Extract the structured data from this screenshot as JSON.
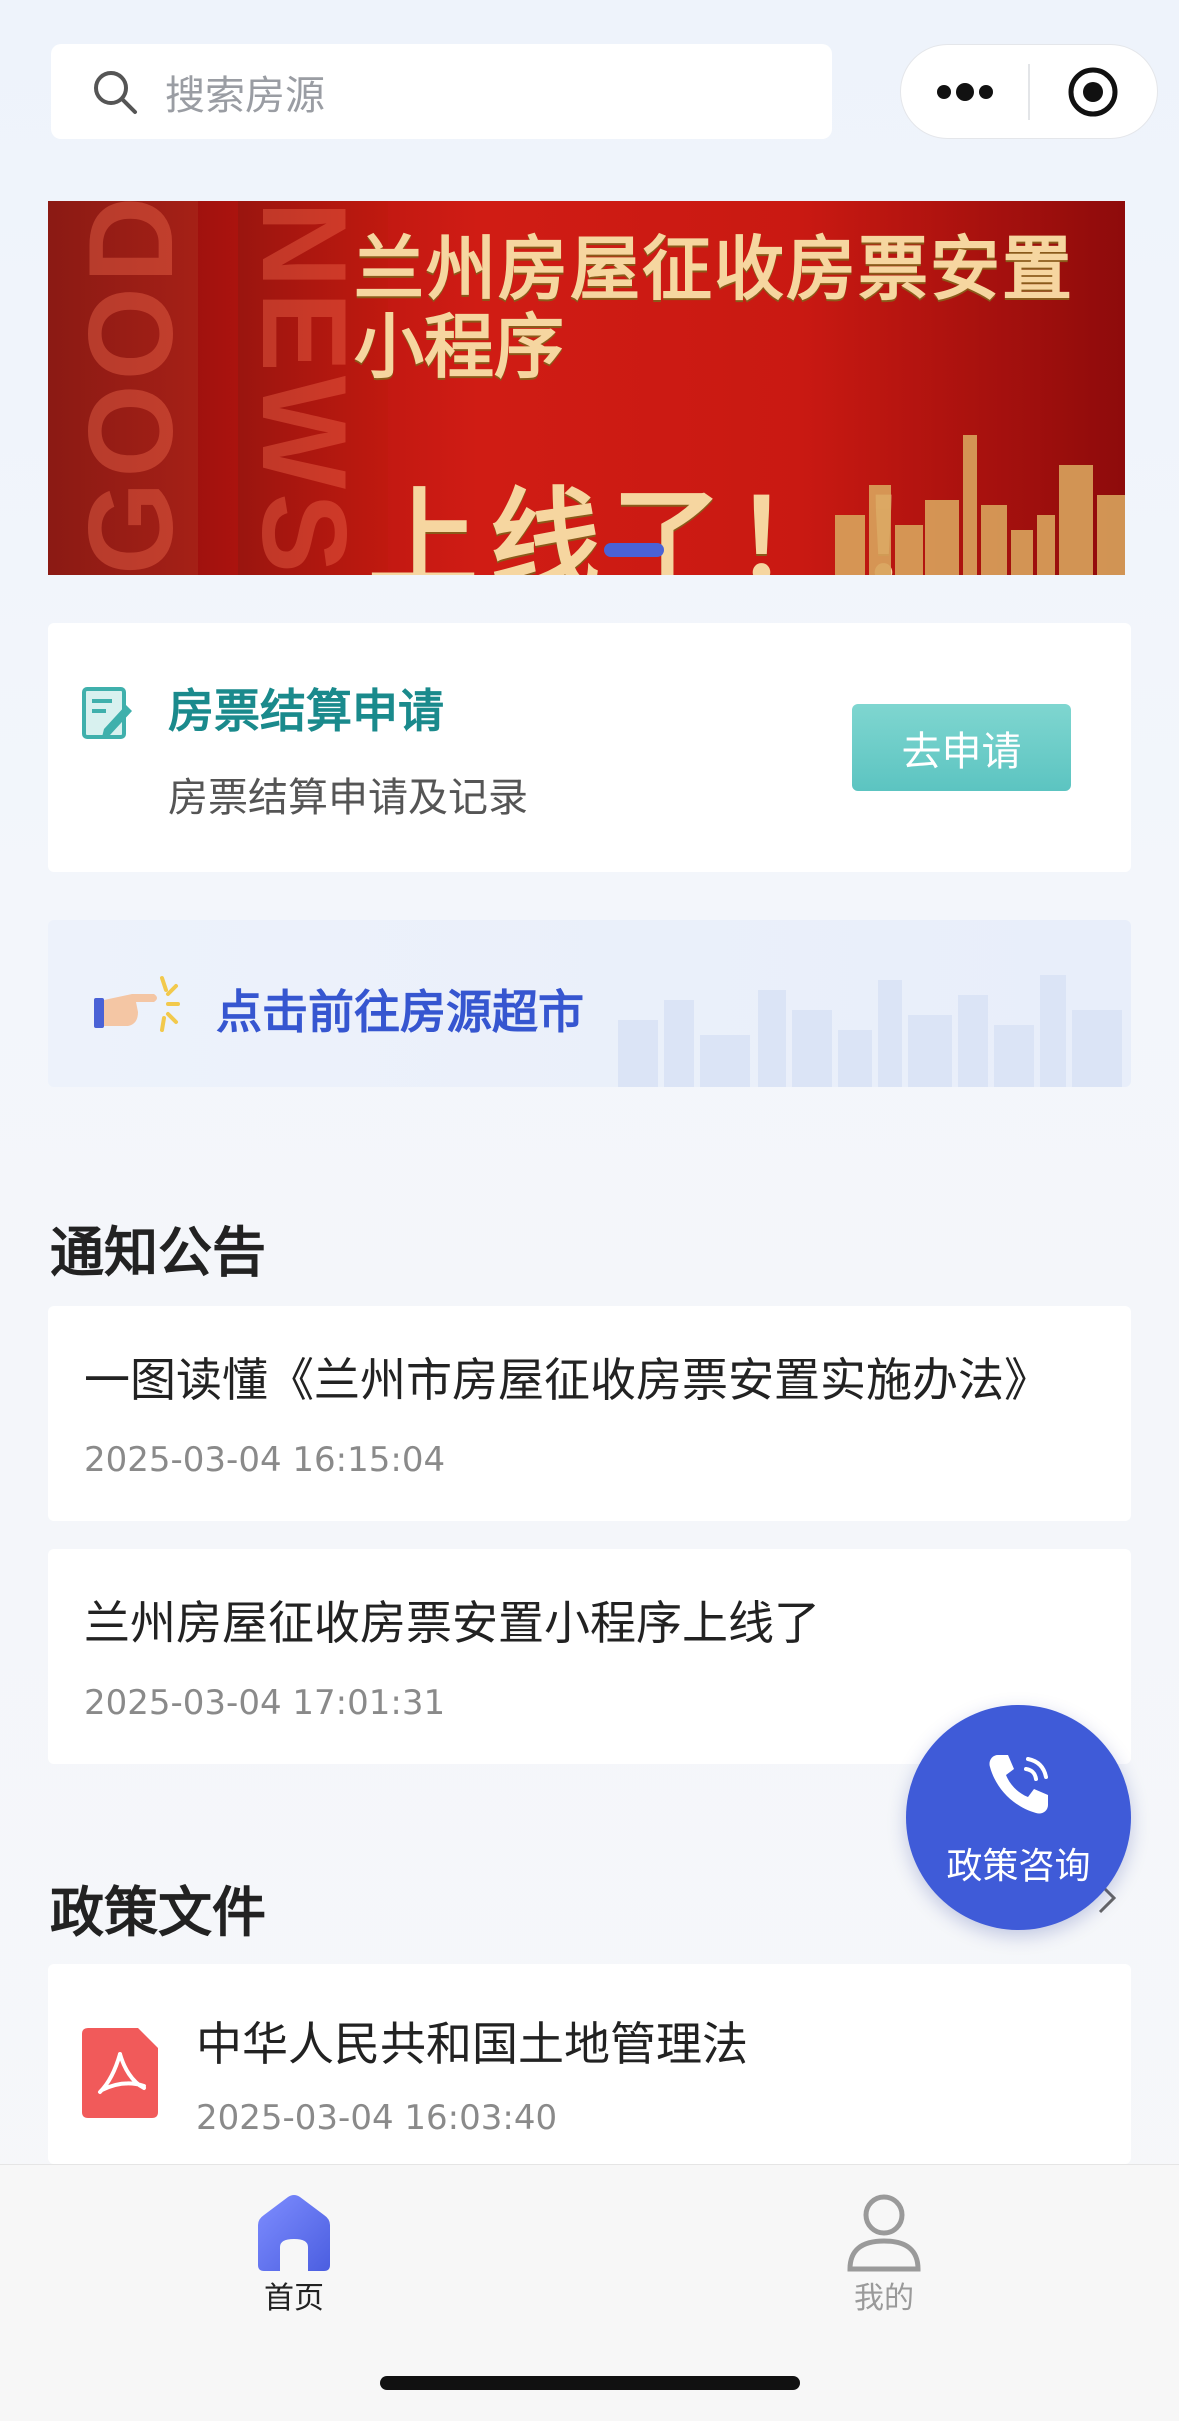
{
  "search": {
    "placeholder": "搜索房源",
    "icon": "search-icon"
  },
  "capsule": {
    "menu_icon": "more-dots-icon",
    "close_icon": "target-icon"
  },
  "banner": {
    "line1": "兰州房屋征收房票安置",
    "line2": "小程序",
    "line3": "上线了！！",
    "deco_text_1": "GOOD",
    "deco_text_2": "NEWS"
  },
  "settlement": {
    "title": "房票结算申请",
    "subtitle": "房票结算申请及记录",
    "button": "去申请",
    "icon": "edit-icon"
  },
  "market": {
    "label": "点击前往房源超市",
    "icon": "pointing-hand-icon"
  },
  "notices": {
    "heading": "通知公告",
    "items": [
      {
        "title": "一图读懂《兰州市房屋征收房票安置实施办法》",
        "time": "2025-03-04 16:15:04"
      },
      {
        "title": "兰州房屋征收房票安置小程序上线了",
        "time": "2025-03-04 17:01:31"
      }
    ]
  },
  "policies": {
    "heading": "政策文件",
    "items": [
      {
        "title": "中华人民共和国土地管理法",
        "time": "2025-03-04 16:03:40",
        "icon": "pdf-icon"
      }
    ]
  },
  "consult": {
    "label": "政策咨询",
    "icon": "phone-icon"
  },
  "tabbar": {
    "items": [
      {
        "label": "首页",
        "icon": "home-icon",
        "active": true
      },
      {
        "label": "我的",
        "icon": "user-icon",
        "active": false
      }
    ]
  },
  "colors": {
    "accent": "#3f5bd8",
    "teal": "#1a8a8c",
    "apply_button": "#6ccdc8",
    "banner_red": "#c91912"
  }
}
